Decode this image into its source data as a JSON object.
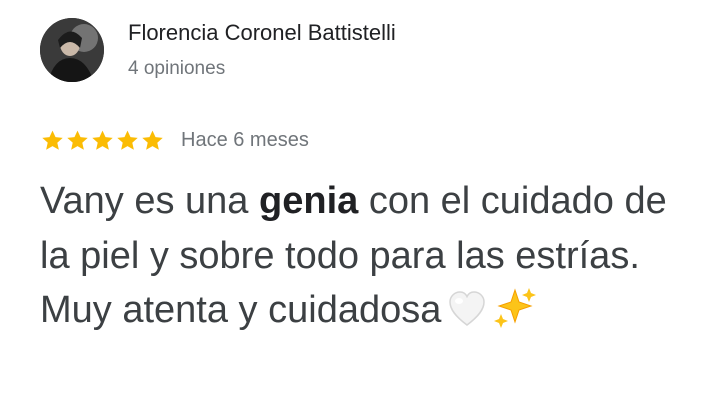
{
  "review": {
    "reviewer_name": "Florencia Coronel Battistelli",
    "review_count": "4 opiniones",
    "rating": 5,
    "rating_max": 5,
    "star_color": "#fbbc04",
    "time_ago": "Hace 6 meses",
    "text_before": "Vany es una ",
    "text_bold": "genia",
    "text_after": " con el cuidado de la piel y sobre todo para las estrías. Muy atenta y cuidadosa",
    "emojis": [
      "white-heart-icon",
      "sparkles-icon"
    ]
  }
}
